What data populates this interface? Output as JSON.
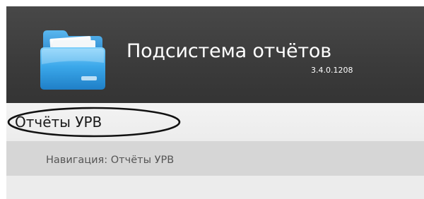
{
  "header": {
    "title": "Подсистема отчётов",
    "version": "3.4.0.1208",
    "logo_icon": "folder-icon"
  },
  "menu": {
    "items": [
      {
        "label": "Отчёты УРВ",
        "highlighted": true
      }
    ]
  },
  "breadcrumb": {
    "text": "Навигация: Отчёты УРВ"
  },
  "colors": {
    "header_bg": "#3b3b3b",
    "menubar_bg": "#ececec",
    "breadcrumb_bg": "#d6d6d6",
    "folder_blue": "#3aa6e6"
  }
}
